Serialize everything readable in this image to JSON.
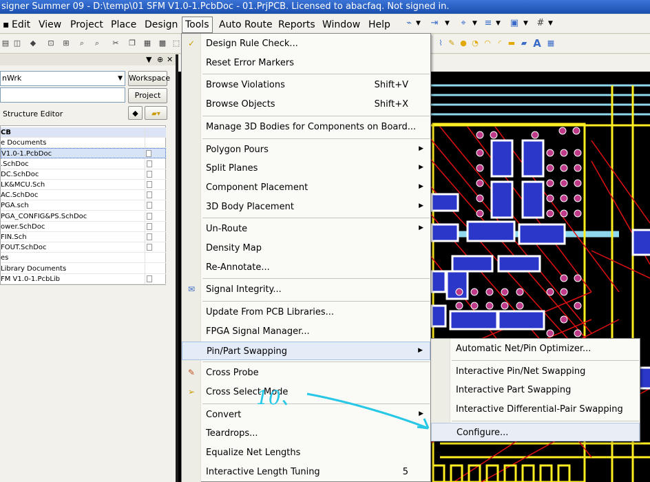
{
  "window": {
    "title": "signer Summer 09 - D:\\temp\\01 SFM V1.0-1.PcbDoc - 01.PrjPCB. Licensed to abacfaq. Not signed in."
  },
  "menubar": {
    "items": [
      "Edit",
      "View",
      "Project",
      "Place",
      "Design",
      "Tools",
      "Auto Route",
      "Reports",
      "Window",
      "Help"
    ],
    "active": "Tools"
  },
  "panel": {
    "workspace_value": "nWrk",
    "workspace_button": "Workspace",
    "project_button": "Project",
    "structure_label": "Structure Editor",
    "rows": [
      {
        "text": "CB",
        "type": "hdr"
      },
      {
        "text": "e Documents",
        "type": "group"
      },
      {
        "text": " V1.0-1.PcbDoc",
        "type": "sel"
      },
      {
        "text": ".SchDoc",
        "type": "doc"
      },
      {
        "text": "DC.SchDoc",
        "type": "doc"
      },
      {
        "text": "LK&MCU.Sch",
        "type": "doc"
      },
      {
        "text": "AC.SchDoc",
        "type": "doc"
      },
      {
        "text": "PGA.sch",
        "type": "doc"
      },
      {
        "text": "PGA_CONFIG&PS.SchDoc",
        "type": "doc"
      },
      {
        "text": "ower.SchDoc",
        "type": "doc"
      },
      {
        "text": "FIN.Sch",
        "type": "doc"
      },
      {
        "text": "FOUT.SchDoc",
        "type": "doc"
      },
      {
        "text": "es",
        "type": "group"
      },
      {
        "text": "Library Documents",
        "type": "group"
      },
      {
        "text": "FM V1.0-1.PcbLib",
        "type": "doc"
      }
    ]
  },
  "tools_menu": {
    "items": [
      {
        "label": "Design Rule Check...",
        "shortcut": "",
        "submenu": false,
        "icon": "drc-icon"
      },
      {
        "label": "Reset Error Markers",
        "shortcut": "",
        "submenu": false,
        "icon": ""
      },
      {
        "sep": true
      },
      {
        "label": "Browse Violations",
        "shortcut": "Shift+V",
        "submenu": false,
        "icon": ""
      },
      {
        "label": "Browse Objects",
        "shortcut": "Shift+X",
        "submenu": false,
        "icon": ""
      },
      {
        "sep": true
      },
      {
        "label": "Manage 3D Bodies for Components on Board...",
        "shortcut": "",
        "submenu": false,
        "icon": ""
      },
      {
        "sep": true
      },
      {
        "label": "Polygon Pours",
        "shortcut": "",
        "submenu": true,
        "icon": ""
      },
      {
        "label": "Split Planes",
        "shortcut": "",
        "submenu": true,
        "icon": ""
      },
      {
        "label": "Component Placement",
        "shortcut": "",
        "submenu": true,
        "icon": ""
      },
      {
        "label": "3D Body Placement",
        "shortcut": "",
        "submenu": true,
        "icon": ""
      },
      {
        "sep": true
      },
      {
        "label": "Un-Route",
        "shortcut": "",
        "submenu": true,
        "icon": ""
      },
      {
        "label": "Density Map",
        "shortcut": "",
        "submenu": false,
        "icon": ""
      },
      {
        "label": "Re-Annotate...",
        "shortcut": "",
        "submenu": false,
        "icon": ""
      },
      {
        "sep": true
      },
      {
        "label": "Signal Integrity...",
        "shortcut": "",
        "submenu": false,
        "icon": "signal-integrity-icon"
      },
      {
        "sep": true
      },
      {
        "label": "Update From PCB Libraries...",
        "shortcut": "",
        "submenu": false,
        "icon": ""
      },
      {
        "label": "FPGA Signal Manager...",
        "shortcut": "",
        "submenu": false,
        "icon": ""
      },
      {
        "label": "Pin/Part Swapping",
        "shortcut": "",
        "submenu": true,
        "icon": "",
        "highlighted": true
      },
      {
        "sep": true
      },
      {
        "label": "Cross Probe",
        "shortcut": "",
        "submenu": false,
        "icon": "cross-probe-icon"
      },
      {
        "label": "Cross Select Mode",
        "shortcut": "",
        "submenu": false,
        "icon": "cross-select-icon"
      },
      {
        "sep": true
      },
      {
        "label": "Convert",
        "shortcut": "",
        "submenu": true,
        "icon": ""
      },
      {
        "label": "Teardrops...",
        "shortcut": "",
        "submenu": false,
        "icon": ""
      },
      {
        "label": "Equalize Net Lengths",
        "shortcut": "",
        "submenu": false,
        "icon": ""
      },
      {
        "label": "Interactive Length Tuning",
        "shortcut": "5",
        "submenu": false,
        "icon": ""
      }
    ]
  },
  "submenu": {
    "items": [
      {
        "label": "Automatic Net/Pin Optimizer..."
      },
      {
        "sep": true
      },
      {
        "label": "Interactive Pin/Net Swapping"
      },
      {
        "label": "Interactive Part Swapping"
      },
      {
        "label": "Interactive Differential-Pair Swapping"
      },
      {
        "sep": true
      },
      {
        "label": "Configure...",
        "highlighted": true
      }
    ]
  },
  "annotation": {
    "text": "10、",
    "color": "#27c7e6"
  },
  "colors": {
    "pcb_bg": "#000000",
    "trace_red": "#e01010",
    "pad_magenta": "#c03a8a",
    "silk_yellow": "#ffee22",
    "pad_blue": "#2a37c8",
    "trace_cyan": "#8fd8ee"
  }
}
